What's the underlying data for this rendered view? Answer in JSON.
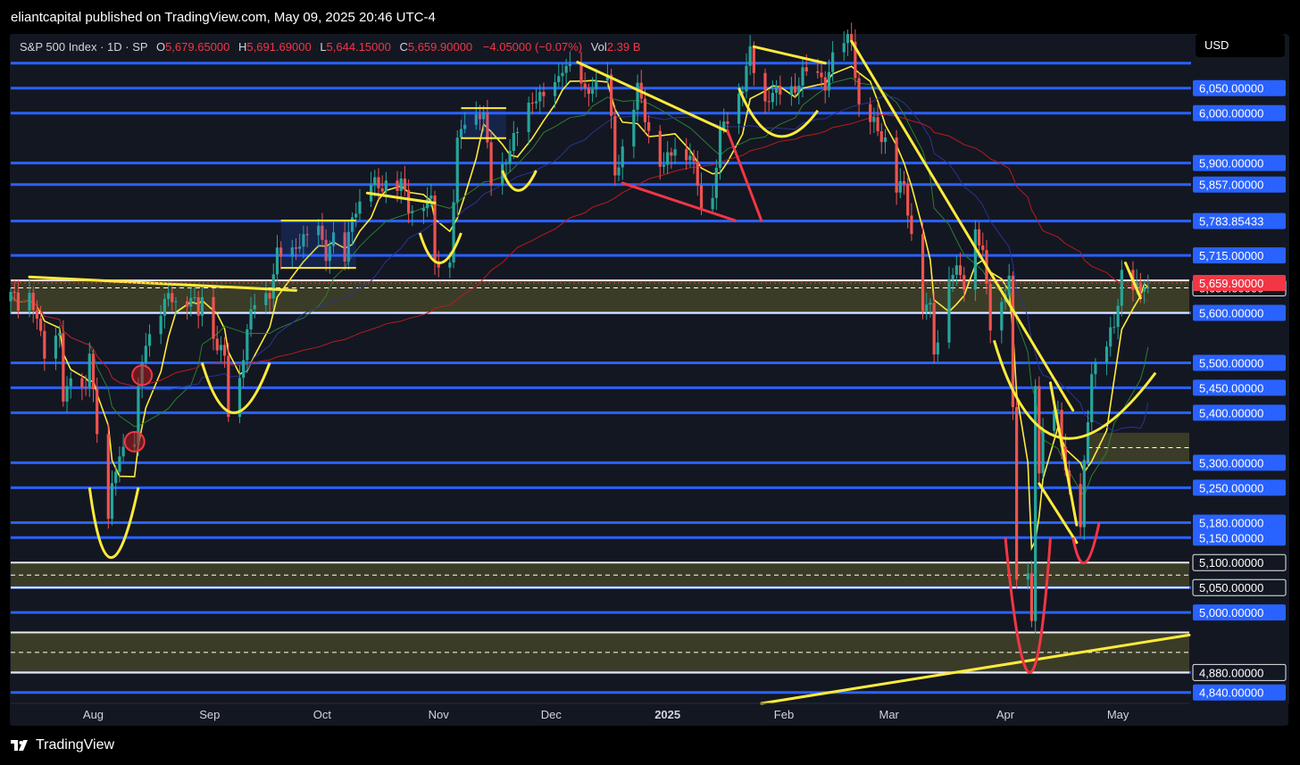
{
  "header": {
    "published": "eliantcapital published on TradingView.com, May 09, 2025 20:46 UTC-4"
  },
  "legend": {
    "symbol": "S&P 500 Index · 1D · SP",
    "open_label": "O",
    "open": "5,679.65000",
    "high_label": "H",
    "high": "5,691.69000",
    "low_label": "L",
    "low": "5,644.15000",
    "close_label": "C",
    "close": "5,659.90000",
    "change": "−4.05000 (−0.07%)",
    "vol_label": "Vol",
    "vol": "2.39 B"
  },
  "currency": "USD",
  "footer": {
    "brand": "TradingView"
  },
  "chart_data": {
    "type": "candlestick",
    "title": "S&P 500 Index · 1D · SP",
    "x_tick_labels": [
      "Aug",
      "Sep",
      "Oct",
      "Nov",
      "Dec",
      "2025",
      "Feb",
      "Mar",
      "Apr",
      "May"
    ],
    "x_tick_dates": [
      "2024-08-01",
      "2024-09-01",
      "2024-10-01",
      "2024-11-01",
      "2024-12-01",
      "2025-01-01",
      "2025-02-01",
      "2025-03-01",
      "2025-04-01",
      "2025-05-01"
    ],
    "x_range": [
      "2024-07-10",
      "2025-05-20"
    ],
    "y_range": [
      4818,
      6155
    ],
    "price_scale_labels": [
      "6,050.00000",
      "6,000.00000",
      "5,900.00000",
      "5,857.00000",
      "5,783.85433",
      "5,715.00000",
      "5,650.00000",
      "5,600.00000",
      "5,500.00000",
      "5,450.00000",
      "5,400.00000",
      "5,300.00000",
      "5,250.00000",
      "5,180.00000",
      "5,150.00000",
      "5,100.00000",
      "5,050.00000",
      "5,000.00000",
      "4,880.00000",
      "4,840.00000"
    ],
    "last_price_label": "5,659.90000",
    "horizontal_levels": [
      6100,
      6050,
      6000,
      5900,
      5857,
      5783.85,
      5715,
      5600,
      5500,
      5450,
      5400,
      5300,
      5250,
      5180,
      5150,
      5050,
      5000,
      4880,
      4840
    ],
    "white_levels": [
      5665,
      5600,
      5100,
      5050,
      4960,
      4880
    ],
    "zones": [
      {
        "from": 5600,
        "to": 5665
      },
      {
        "from": 5050,
        "to": 5100
      },
      {
        "from": 4880,
        "to": 4960
      },
      {
        "from": 5300,
        "to": 5360
      }
    ],
    "dashed_levels": [
      5650,
      5075,
      4920,
      5330
    ],
    "close_series": [
      [
        "2024-07-10",
        5633
      ],
      [
        "2024-07-12",
        5610
      ],
      [
        "2024-07-15",
        5631
      ],
      [
        "2024-07-17",
        5588
      ],
      [
        "2024-07-19",
        5505
      ],
      [
        "2024-07-23",
        5555
      ],
      [
        "2024-07-24",
        5427
      ],
      [
        "2024-07-26",
        5459
      ],
      [
        "2024-07-30",
        5436
      ],
      [
        "2024-07-31",
        5522
      ],
      [
        "2024-08-01",
        5446
      ],
      [
        "2024-08-02",
        5346
      ],
      [
        "2024-08-05",
        5186
      ],
      [
        "2024-08-06",
        5240
      ],
      [
        "2024-08-08",
        5319
      ],
      [
        "2024-08-12",
        5344
      ],
      [
        "2024-08-13",
        5434
      ],
      [
        "2024-08-15",
        5543
      ],
      [
        "2024-08-19",
        5608
      ],
      [
        "2024-08-21",
        5620
      ],
      [
        "2024-08-23",
        5634
      ],
      [
        "2024-08-27",
        5625
      ],
      [
        "2024-08-29",
        5592
      ],
      [
        "2024-08-30",
        5648
      ],
      [
        "2024-09-03",
        5528
      ],
      [
        "2024-09-05",
        5503
      ],
      [
        "2024-09-06",
        5408
      ],
      [
        "2024-09-09",
        5471
      ],
      [
        "2024-09-11",
        5554
      ],
      [
        "2024-09-13",
        5626
      ],
      [
        "2024-09-17",
        5634
      ],
      [
        "2024-09-19",
        5713
      ],
      [
        "2024-09-23",
        5718
      ],
      [
        "2024-09-26",
        5745
      ],
      [
        "2024-09-30",
        5762
      ],
      [
        "2024-10-02",
        5709
      ],
      [
        "2024-10-04",
        5751
      ],
      [
        "2024-10-07",
        5696
      ],
      [
        "2024-10-09",
        5792
      ],
      [
        "2024-10-11",
        5815
      ],
      [
        "2024-10-14",
        5859
      ],
      [
        "2024-10-16",
        5842
      ],
      [
        "2024-10-18",
        5864
      ],
      [
        "2024-10-22",
        5851
      ],
      [
        "2024-10-24",
        5809
      ],
      [
        "2024-10-28",
        5823
      ],
      [
        "2024-10-30",
        5813
      ],
      [
        "2024-10-31",
        5705
      ],
      [
        "2024-11-04",
        5712
      ],
      [
        "2024-11-06",
        5929
      ],
      [
        "2024-11-08",
        5995
      ],
      [
        "2024-11-11",
        6001
      ],
      [
        "2024-11-13",
        5985
      ],
      [
        "2024-11-15",
        5870
      ],
      [
        "2024-11-18",
        5893
      ],
      [
        "2024-11-20",
        5917
      ],
      [
        "2024-11-22",
        5969
      ],
      [
        "2024-11-26",
        6021
      ],
      [
        "2024-11-29",
        6032
      ],
      [
        "2024-12-02",
        6047
      ],
      [
        "2024-12-04",
        6086
      ],
      [
        "2024-12-06",
        6090
      ],
      [
        "2024-12-10",
        6034
      ],
      [
        "2024-12-12",
        6051
      ],
      [
        "2024-12-16",
        6074
      ],
      [
        "2024-12-18",
        5872
      ],
      [
        "2024-12-20",
        5930
      ],
      [
        "2024-12-24",
        6040
      ],
      [
        "2024-12-27",
        5970
      ],
      [
        "2024-12-31",
        5882
      ],
      [
        "2025-01-03",
        5942
      ],
      [
        "2025-01-07",
        5909
      ],
      [
        "2025-01-10",
        5827
      ],
      [
        "2025-01-13",
        5836
      ],
      [
        "2025-01-15",
        5950
      ],
      [
        "2025-01-17",
        5997
      ],
      [
        "2025-01-21",
        6049
      ],
      [
        "2025-01-23",
        6119
      ],
      [
        "2025-01-27",
        6012
      ],
      [
        "2025-01-29",
        6039
      ],
      [
        "2025-01-31",
        6040
      ],
      [
        "2025-02-04",
        6037
      ],
      [
        "2025-02-06",
        6083
      ],
      [
        "2025-02-10",
        6066
      ],
      [
        "2025-02-12",
        6051
      ],
      [
        "2025-02-14",
        6114
      ],
      [
        "2025-02-19",
        6144
      ],
      [
        "2025-02-21",
        6013
      ],
      [
        "2025-02-24",
        5983
      ],
      [
        "2025-02-26",
        5956
      ],
      [
        "2025-02-28",
        5954
      ],
      [
        "2025-03-03",
        5849
      ],
      [
        "2025-03-05",
        5842
      ],
      [
        "2025-03-07",
        5770
      ],
      [
        "2025-03-10",
        5614
      ],
      [
        "2025-03-12",
        5599
      ],
      [
        "2025-03-13",
        5521
      ],
      [
        "2025-03-17",
        5675
      ],
      [
        "2025-03-19",
        5675
      ],
      [
        "2025-03-21",
        5667
      ],
      [
        "2025-03-24",
        5767
      ],
      [
        "2025-03-26",
        5712
      ],
      [
        "2025-03-28",
        5581
      ],
      [
        "2025-03-31",
        5612
      ],
      [
        "2025-04-02",
        5670
      ],
      [
        "2025-04-03",
        5397
      ],
      [
        "2025-04-04",
        5074
      ],
      [
        "2025-04-07",
        5062
      ],
      [
        "2025-04-08",
        4982
      ],
      [
        "2025-04-09",
        5457
      ],
      [
        "2025-04-10",
        5268
      ],
      [
        "2025-04-11",
        5363
      ],
      [
        "2025-04-15",
        5396
      ],
      [
        "2025-04-17",
        5282
      ],
      [
        "2025-04-21",
        5158
      ],
      [
        "2025-04-22",
        5287
      ],
      [
        "2025-04-24",
        5484
      ],
      [
        "2025-04-28",
        5528
      ],
      [
        "2025-04-30",
        5569
      ],
      [
        "2025-05-02",
        5686
      ],
      [
        "2025-05-05",
        5650
      ],
      [
        "2025-05-07",
        5631
      ],
      [
        "2025-05-08",
        5664
      ],
      [
        "2025-05-09",
        5660
      ]
    ]
  }
}
